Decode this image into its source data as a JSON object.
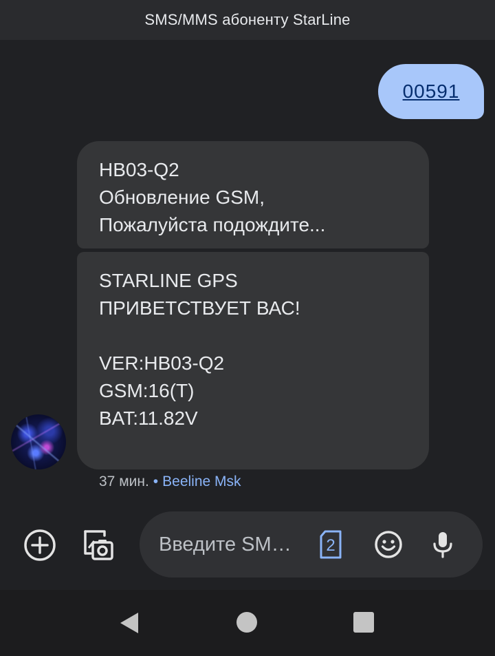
{
  "header": {
    "title": "SMS/MMS абоненту StarLine"
  },
  "messages": {
    "outgoing": {
      "text": "00591"
    },
    "incoming": [
      {
        "text": "HB03-Q2\nОбновление GSM,\nПожалуйста подождите..."
      },
      {
        "text": "STARLINE GPS\nПРИВЕТСТВУЕТ ВАС!\n\nVER:HB03-Q2\nGSM:16(T)\nBAT:11.82V"
      }
    ],
    "meta": {
      "time": "37 мин.",
      "separator": "•",
      "carrier": "Beeline Msk"
    }
  },
  "composer": {
    "placeholder": "Введите SMS-сообщение",
    "sim_label": "2",
    "icons": [
      "add-icon",
      "gallery-icon",
      "sim-icon",
      "emoji-icon",
      "mic-icon"
    ]
  },
  "colors": {
    "background": "#202124",
    "outgoing_bubble": "#a8c7fa",
    "incoming_bubble": "#353638",
    "accent": "#8ab4f8"
  }
}
